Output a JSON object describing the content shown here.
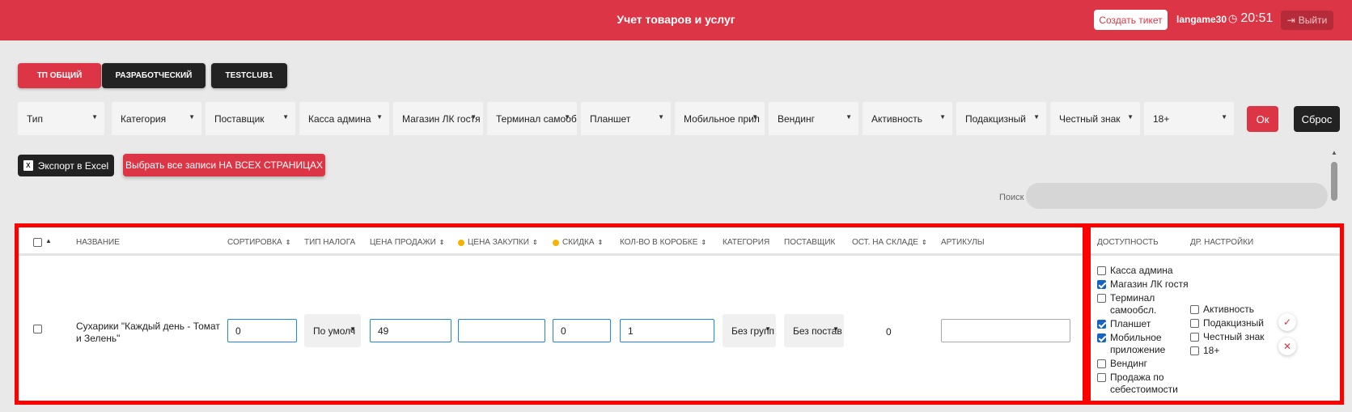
{
  "header": {
    "title": "Учет товаров и услуг",
    "create_ticket_label": "Создать тикет",
    "username": "langame30",
    "time": "20:51",
    "logout_label": "Выйти",
    "clock_icon": "clock-icon",
    "logout_icon": "logout-icon"
  },
  "clubs": [
    {
      "label": "ТП ОБЩИЙ",
      "active": true
    },
    {
      "label": "РАЗРАБОТЧЕСКИЙ",
      "active": false
    },
    {
      "label": "TESTCLUB1",
      "active": false
    }
  ],
  "filters": [
    "Тип",
    "Категория",
    "Поставщик",
    "Касса админа",
    "Магазин ЛК гостя",
    "Терминал самообс",
    "Планшет",
    "Мобильное прил",
    "Вендинг",
    "Активность",
    "Подакцизный",
    "Честный знак",
    "18+"
  ],
  "filter_actions": {
    "ok_label": "Ок",
    "reset_label": "Сброс"
  },
  "toolbar": {
    "export_label": "Экспорт в Excel",
    "excel_icon_text": "X",
    "select_all_label": "Выбрать все записи НА ВСЕХ СТРАНИЦАХ"
  },
  "search": {
    "label": "Поиск",
    "value": ""
  },
  "table": {
    "headers": {
      "name": "НАЗВАНИЕ",
      "sort": "СОРТИРОВКА",
      "tax": "ТИП НАЛОГА",
      "price": "ЦЕНА ПРОДАЖИ",
      "purchase": "ЦЕНА ЗАКУПКИ",
      "discount": "СКИДКА",
      "box": "КОЛ-ВО В КОРОБКЕ",
      "category": "КАТЕГОРИЯ",
      "supplier": "ПОСТАВЩИК",
      "stock": "ОСТ. НА СКЛАДЕ",
      "articles": "АРТИКУЛЫ"
    },
    "row": {
      "name": "Сухарики \"Каждый день - Томат и Зелень\"",
      "sort": "0",
      "tax": "По умолч",
      "price": "49",
      "purchase": "",
      "discount": "0",
      "box": "1",
      "category": "Без групп",
      "supplier": "Без постав",
      "stock": "0",
      "articles": ""
    }
  },
  "side": {
    "headers": {
      "availability": "ДОСТУПНОСТЬ",
      "other": "ДР. НАСТРОЙКИ"
    },
    "availability": [
      {
        "label": "Касса админа",
        "checked": false
      },
      {
        "label": "Магазин ЛК гостя",
        "checked": true
      },
      {
        "label": "Терминал самообсл.",
        "checked": false
      },
      {
        "label": "Планшет",
        "checked": true
      },
      {
        "label": "Мобильное приложение",
        "checked": true
      },
      {
        "label": "Вендинг",
        "checked": false
      },
      {
        "label": "Продажа по себестоимости",
        "checked": false
      }
    ],
    "other": [
      {
        "label": "Активность",
        "checked": false
      },
      {
        "label": "Подакцизный",
        "checked": false
      },
      {
        "label": "Честный знак",
        "checked": false
      },
      {
        "label": "18+",
        "checked": false
      }
    ],
    "confirm_icon": "check-icon",
    "cancel_icon": "close-icon"
  },
  "colors": {
    "brand": "#dc3545",
    "dark": "#222222",
    "highlight": "#ff0000",
    "checkbox": "#1565c0"
  }
}
